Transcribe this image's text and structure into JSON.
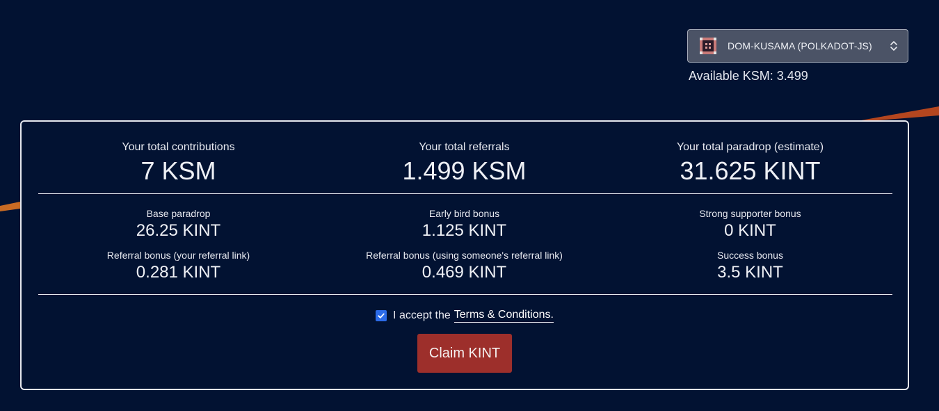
{
  "account": {
    "name": "DOM-KUSAMA (POLKADOT-JS)",
    "identicon": "identicon-icon",
    "chevron": "chevron-up-down-icon"
  },
  "available": "Available KSM: 3.499",
  "totals": [
    {
      "label": "Your total contributions",
      "value": "7 KSM"
    },
    {
      "label": "Your total referrals",
      "value": "1.499 KSM"
    },
    {
      "label": "Your total paradrop (estimate)",
      "value": "31.625 KINT"
    }
  ],
  "breakdown_row1": [
    {
      "label": "Base paradrop",
      "value": "26.25 KINT"
    },
    {
      "label": "Early bird bonus",
      "value": "1.125 KINT"
    },
    {
      "label": "Strong supporter bonus",
      "value": "0 KINT"
    }
  ],
  "breakdown_row2": [
    {
      "label": "Referral bonus (your referral link)",
      "value": "0.281 KINT"
    },
    {
      "label": "Referral bonus (using someone's referral link)",
      "value": "0.469 KINT"
    },
    {
      "label": "Success bonus",
      "value": "3.5 KINT"
    }
  ],
  "terms": {
    "prefix": "I accept the",
    "link": "Terms & Conditions.",
    "checked": true
  },
  "claim_button": "Claim KINT",
  "colors": {
    "background": "#021232",
    "accent_orange": "#b4461f",
    "claim_button": "#9d2f2b",
    "checkbox": "#2c6be8"
  }
}
